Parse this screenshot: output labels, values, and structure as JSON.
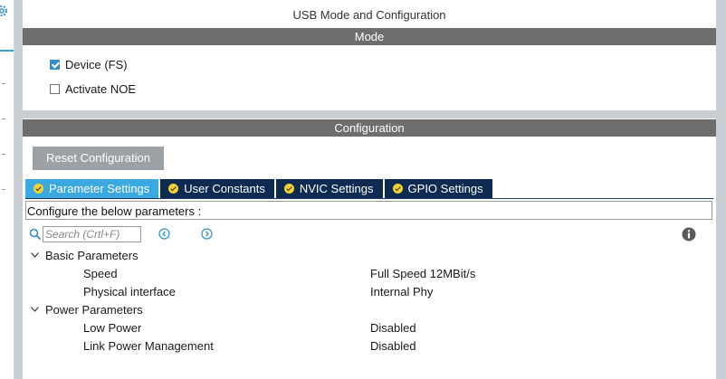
{
  "header": {
    "title": "USB Mode and Configuration"
  },
  "mode": {
    "section_label": "Mode",
    "options": [
      {
        "label": "Device (FS)",
        "checked": true
      },
      {
        "label": "Activate NOE",
        "checked": false
      }
    ]
  },
  "configuration": {
    "section_label": "Configuration",
    "reset_label": "Reset Configuration",
    "tabs": [
      {
        "label": "Parameter Settings",
        "active": true
      },
      {
        "label": "User Constants",
        "active": false
      },
      {
        "label": "NVIC Settings",
        "active": false
      },
      {
        "label": "GPIO Settings",
        "active": false
      }
    ],
    "description": "Configure the below parameters :",
    "search": {
      "placeholder": "Search (Crtl+F)"
    },
    "groups": [
      {
        "label": "Basic Parameters",
        "params": [
          {
            "name": "Speed",
            "value": "Full Speed 12MBit/s"
          },
          {
            "name": "Physical interface",
            "value": "Internal Phy"
          }
        ]
      },
      {
        "label": "Power Parameters",
        "params": [
          {
            "name": "Low Power",
            "value": "Disabled"
          },
          {
            "name": "Link Power Management",
            "value": "Disabled"
          }
        ]
      }
    ]
  },
  "colors": {
    "section_bar": "#6e6e6e",
    "tab_active": "#3ca8e0",
    "tab_inactive": "#0d2b52",
    "tab_ok_icon": "#f2d22e",
    "checkbox_checked": "#2f8fd1",
    "gutter": "#c8ced2"
  }
}
